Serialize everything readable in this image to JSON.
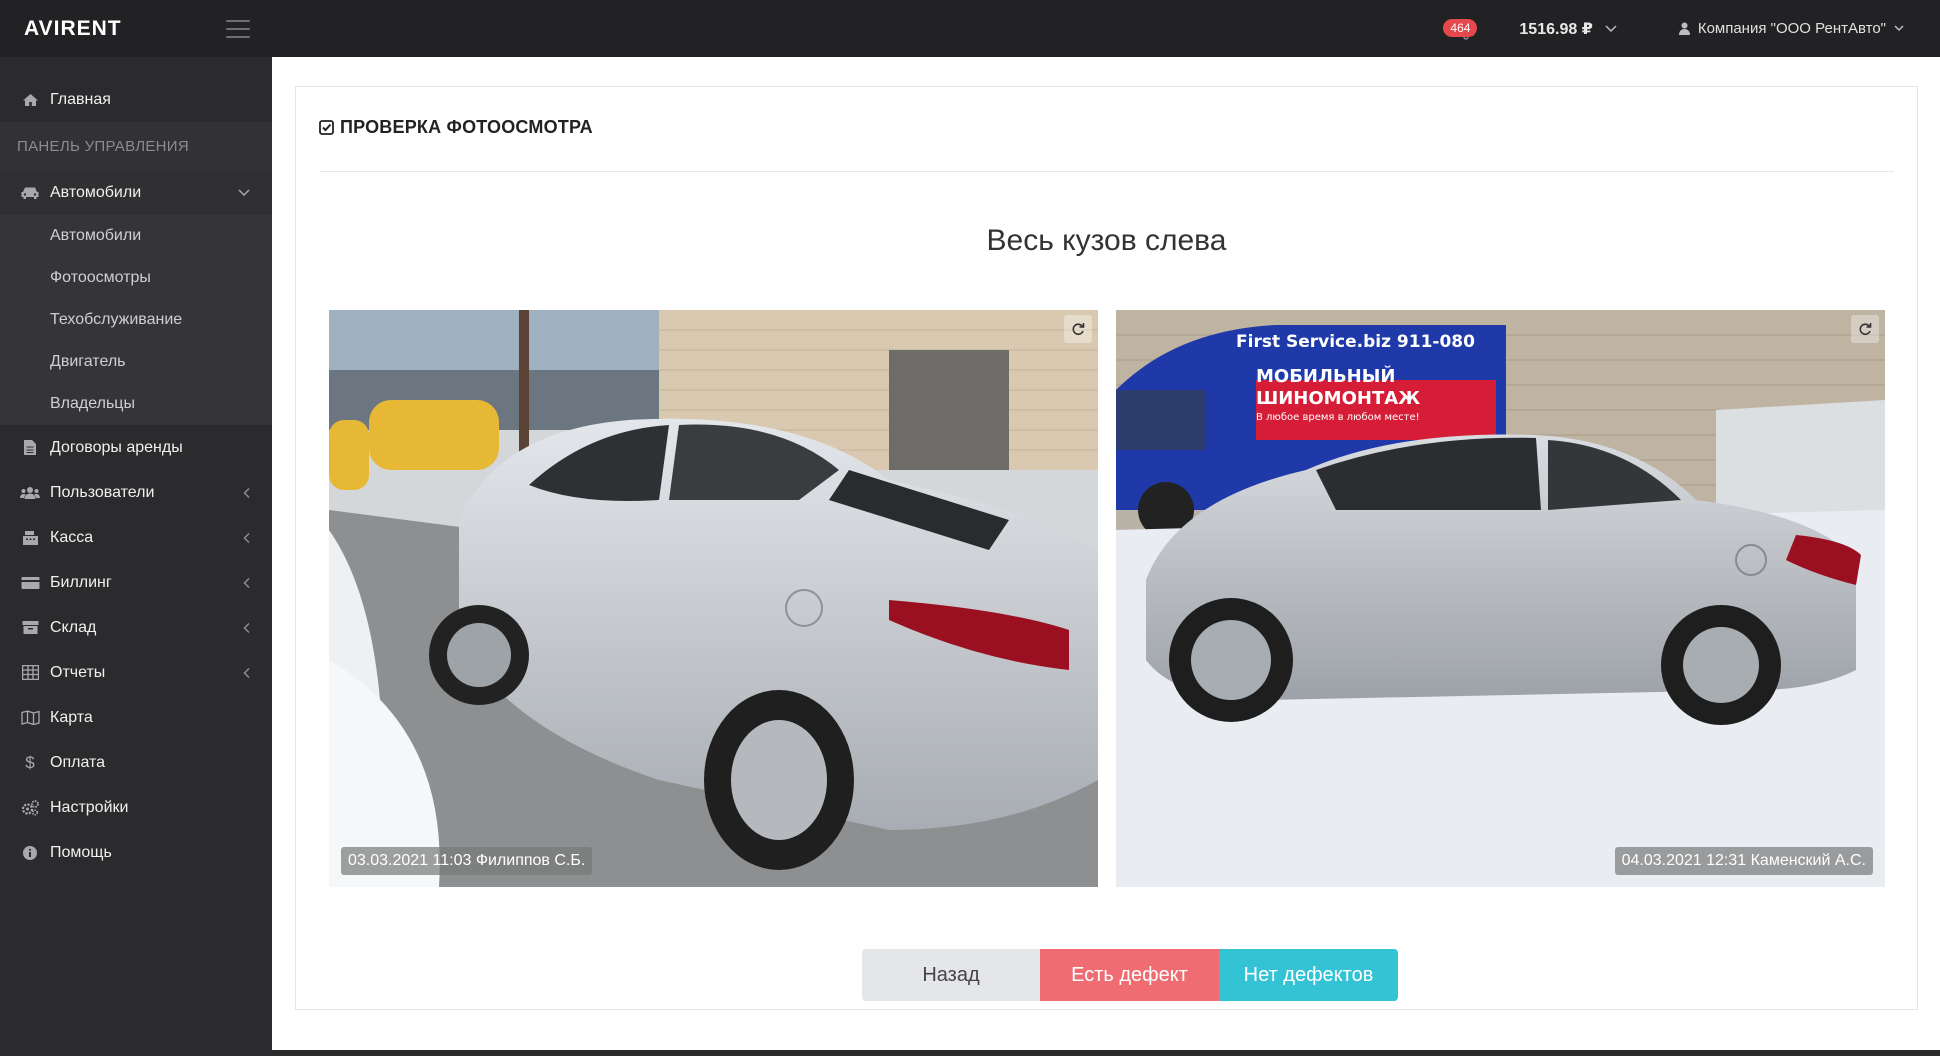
{
  "topbar": {
    "brand": "AVIRENT",
    "notifications_count": "464",
    "balance": "1516.98 ₽",
    "company": "Компания \"ООО РентАвто\""
  },
  "sidebar": {
    "home": "Главная",
    "section_header": "ПАНЕЛЬ УПРАВЛЕНИЯ",
    "cars_group": {
      "label": "Автомобили",
      "items": [
        "Автомобили",
        "Фотоосмотры",
        "Техобслуживание",
        "Двигатель",
        "Владельцы"
      ]
    },
    "items": [
      {
        "label": "Договоры аренды",
        "icon": "file-icon"
      },
      {
        "label": "Пользователи",
        "icon": "users-icon"
      },
      {
        "label": "Касса",
        "icon": "register-icon"
      },
      {
        "label": "Биллинг",
        "icon": "credit-card-icon"
      },
      {
        "label": "Склад",
        "icon": "archive-icon"
      },
      {
        "label": "Отчеты",
        "icon": "table-icon"
      },
      {
        "label": "Карта",
        "icon": "map-icon"
      },
      {
        "label": "Оплата",
        "icon": "dollar-icon"
      },
      {
        "label": "Настройки",
        "icon": "cogs-icon"
      },
      {
        "label": "Помощь",
        "icon": "info-icon"
      }
    ]
  },
  "main": {
    "card_title": "ПРОВЕРКА ФОТООСМОТРА",
    "photo_caption": "Весь кузов слева",
    "photos": [
      {
        "stamp": "03.03.2021 11:03 Филиппов С.Б."
      },
      {
        "stamp": "04.03.2021 12:31 Каменский А.С.",
        "banner_line1": "First Service.biz  911-080",
        "banner_line2": "МОБИЛЬНЫЙ ШИНОМОНТАЖ",
        "banner_line3": "В любое время в любом месте!"
      }
    ],
    "buttons": {
      "back": "Назад",
      "defect": "Есть дефект",
      "no_defects": "Нет дефектов"
    }
  },
  "colors": {
    "topbar_bg": "#222224",
    "sidebar_bg": "#2b2b2d",
    "defect": "#ef6c73",
    "no_defects": "#34c3d5",
    "back": "#e4e6ea",
    "badge": "#e5484d"
  }
}
